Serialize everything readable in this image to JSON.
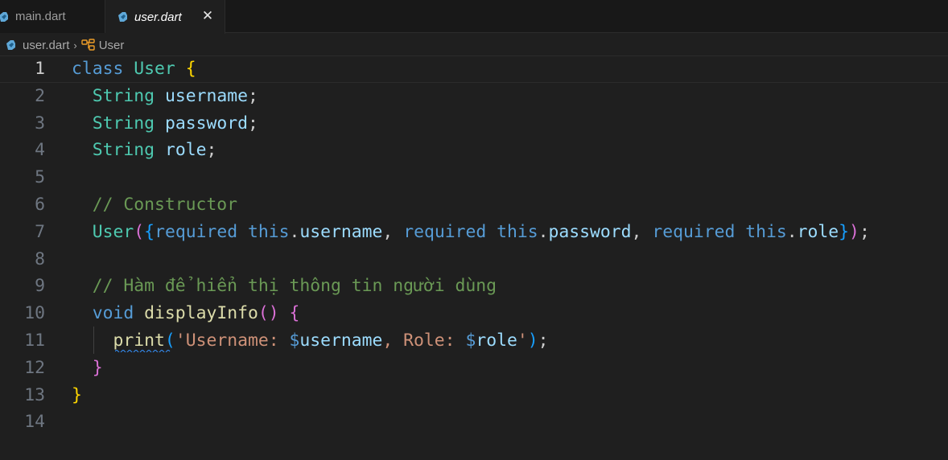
{
  "tabs": [
    {
      "label": "main.dart",
      "icon": "dart-icon",
      "active": false
    },
    {
      "label": "user.dart",
      "icon": "dart-icon",
      "active": true,
      "close_icon": "close-icon"
    }
  ],
  "tab_close_glyph": "✕",
  "breadcrumb": {
    "file": "user.dart",
    "separator": "›",
    "symbol": "User",
    "symbol_icon": "class-symbol-icon"
  },
  "editor": {
    "current_line": 1,
    "line_numbers": [
      "1",
      "2",
      "3",
      "4",
      "5",
      "6",
      "7",
      "8",
      "9",
      "10",
      "11",
      "12",
      "13",
      "14"
    ],
    "lines": [
      {
        "tokens": [
          [
            "kw",
            "class"
          ],
          [
            "pn",
            " "
          ],
          [
            "ty",
            "User"
          ],
          [
            "pn",
            " "
          ],
          [
            "b1",
            "{"
          ]
        ]
      },
      {
        "tokens": [
          [
            "pn",
            "  "
          ],
          [
            "ty",
            "String"
          ],
          [
            "pn",
            " "
          ],
          [
            "id",
            "username"
          ],
          [
            "pn",
            ";"
          ]
        ]
      },
      {
        "tokens": [
          [
            "pn",
            "  "
          ],
          [
            "ty",
            "String"
          ],
          [
            "pn",
            " "
          ],
          [
            "id",
            "password"
          ],
          [
            "pn",
            ";"
          ]
        ]
      },
      {
        "tokens": [
          [
            "pn",
            "  "
          ],
          [
            "ty",
            "String"
          ],
          [
            "pn",
            " "
          ],
          [
            "id",
            "role"
          ],
          [
            "pn",
            ";"
          ]
        ]
      },
      {
        "tokens": []
      },
      {
        "tokens": [
          [
            "pn",
            "  "
          ],
          [
            "cm",
            "// Constructor"
          ]
        ]
      },
      {
        "tokens": [
          [
            "pn",
            "  "
          ],
          [
            "ty",
            "User"
          ],
          [
            "b2",
            "("
          ],
          [
            "b3",
            "{"
          ],
          [
            "kw",
            "required"
          ],
          [
            "pn",
            " "
          ],
          [
            "kw",
            "this"
          ],
          [
            "pn",
            "."
          ],
          [
            "id",
            "username"
          ],
          [
            "pn",
            ", "
          ],
          [
            "kw",
            "required"
          ],
          [
            "pn",
            " "
          ],
          [
            "kw",
            "this"
          ],
          [
            "pn",
            "."
          ],
          [
            "id",
            "password"
          ],
          [
            "pn",
            ", "
          ],
          [
            "kw",
            "required"
          ],
          [
            "pn",
            " "
          ],
          [
            "kw",
            "this"
          ],
          [
            "pn",
            "."
          ],
          [
            "id",
            "role"
          ],
          [
            "b3",
            "}"
          ],
          [
            "b2",
            ")"
          ],
          [
            "pn",
            ";"
          ]
        ]
      },
      {
        "tokens": []
      },
      {
        "tokens": [
          [
            "pn",
            "  "
          ],
          [
            "cm",
            "// Hàm để hiển thị thông tin người dùng"
          ]
        ]
      },
      {
        "tokens": [
          [
            "pn",
            "  "
          ],
          [
            "kw",
            "void"
          ],
          [
            "pn",
            " "
          ],
          [
            "fn",
            "displayInfo"
          ],
          [
            "b2",
            "()"
          ],
          [
            "pn",
            " "
          ],
          [
            "b2",
            "{"
          ]
        ]
      },
      {
        "tokens": [
          [
            "pn",
            "    "
          ],
          [
            "fn",
            "print"
          ],
          [
            "b3",
            "("
          ],
          [
            "st",
            "'Username: "
          ],
          [
            "kw",
            "$"
          ],
          [
            "id",
            "username"
          ],
          [
            "st",
            ", Role: "
          ],
          [
            "kw",
            "$"
          ],
          [
            "id",
            "role"
          ],
          [
            "st",
            "'"
          ],
          [
            "b3",
            ")"
          ],
          [
            "pn",
            ";"
          ]
        ]
      },
      {
        "tokens": [
          [
            "pn",
            "  "
          ],
          [
            "b2",
            "}"
          ]
        ]
      },
      {
        "tokens": [
          [
            "b1",
            "}"
          ]
        ]
      },
      {
        "tokens": []
      }
    ]
  }
}
